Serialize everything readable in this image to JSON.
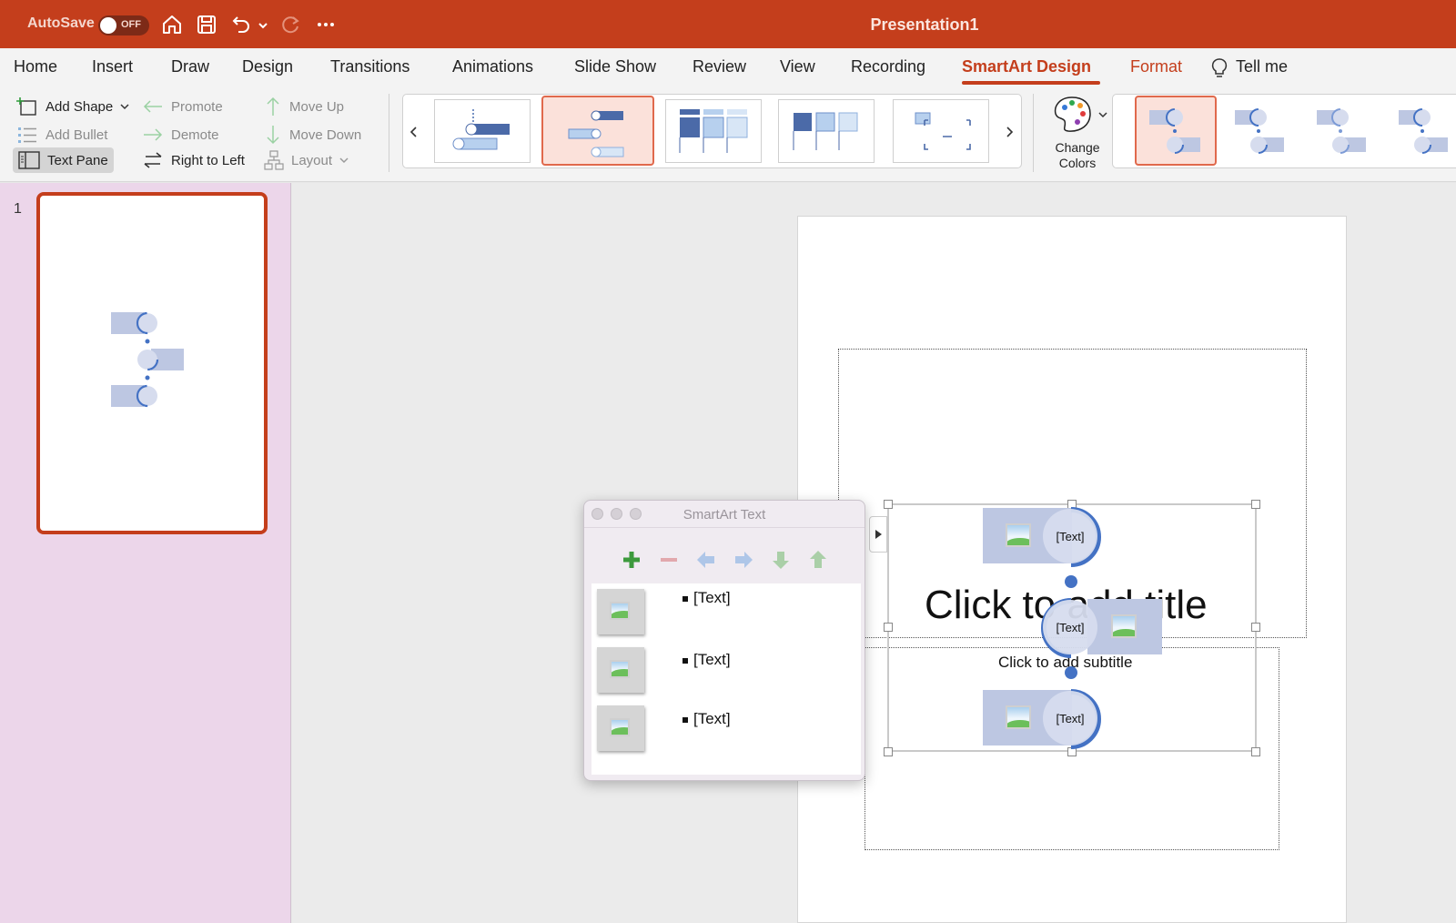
{
  "titlebar": {
    "autosave_label": "AutoSave",
    "autosave_state": "OFF",
    "document_title": "Presentation1",
    "icons": [
      "home-icon",
      "save-icon",
      "undo-icon",
      "undo-dropdown-icon",
      "redo-icon",
      "more-icon"
    ]
  },
  "tabs": [
    {
      "label": "Home"
    },
    {
      "label": "Insert"
    },
    {
      "label": "Draw"
    },
    {
      "label": "Design"
    },
    {
      "label": "Transitions"
    },
    {
      "label": "Animations"
    },
    {
      "label": "Slide Show"
    },
    {
      "label": "Review"
    },
    {
      "label": "View"
    },
    {
      "label": "Recording"
    },
    {
      "label": "SmartArt Design",
      "active": true
    },
    {
      "label": "Format"
    },
    {
      "label": "Tell me"
    }
  ],
  "ribbon": {
    "add_shape": "Add Shape",
    "add_bullet": "Add Bullet",
    "text_pane": "Text Pane",
    "promote": "Promote",
    "demote": "Demote",
    "right_to_left": "Right to Left",
    "move_up": "Move Up",
    "move_down": "Move Down",
    "layout": "Layout",
    "change_colors_line1": "Change",
    "change_colors_line2": "Colors",
    "layout_gallery_selected_index": 1,
    "style_gallery_selected_index": 0
  },
  "slides_pane": {
    "slide_number": "1"
  },
  "slide": {
    "title_placeholder": "Click to add title",
    "subtitle_placeholder": "Click to add subtitle",
    "nodes": [
      {
        "text": "[Text]"
      },
      {
        "text": "[Text]"
      },
      {
        "text": "[Text]"
      }
    ]
  },
  "smartart_text_pane": {
    "title": "SmartArt Text",
    "toolbar": [
      "add-icon",
      "remove-icon",
      "promote-icon",
      "demote-icon",
      "move-down-icon",
      "move-up-icon"
    ],
    "items": [
      {
        "text": "[Text]"
      },
      {
        "text": "[Text]"
      },
      {
        "text": "[Text]"
      }
    ]
  },
  "colors": {
    "accent": "#c43e1c",
    "smartart_blue": "#4472c4",
    "smartart_fill": "#bdc7e2"
  }
}
